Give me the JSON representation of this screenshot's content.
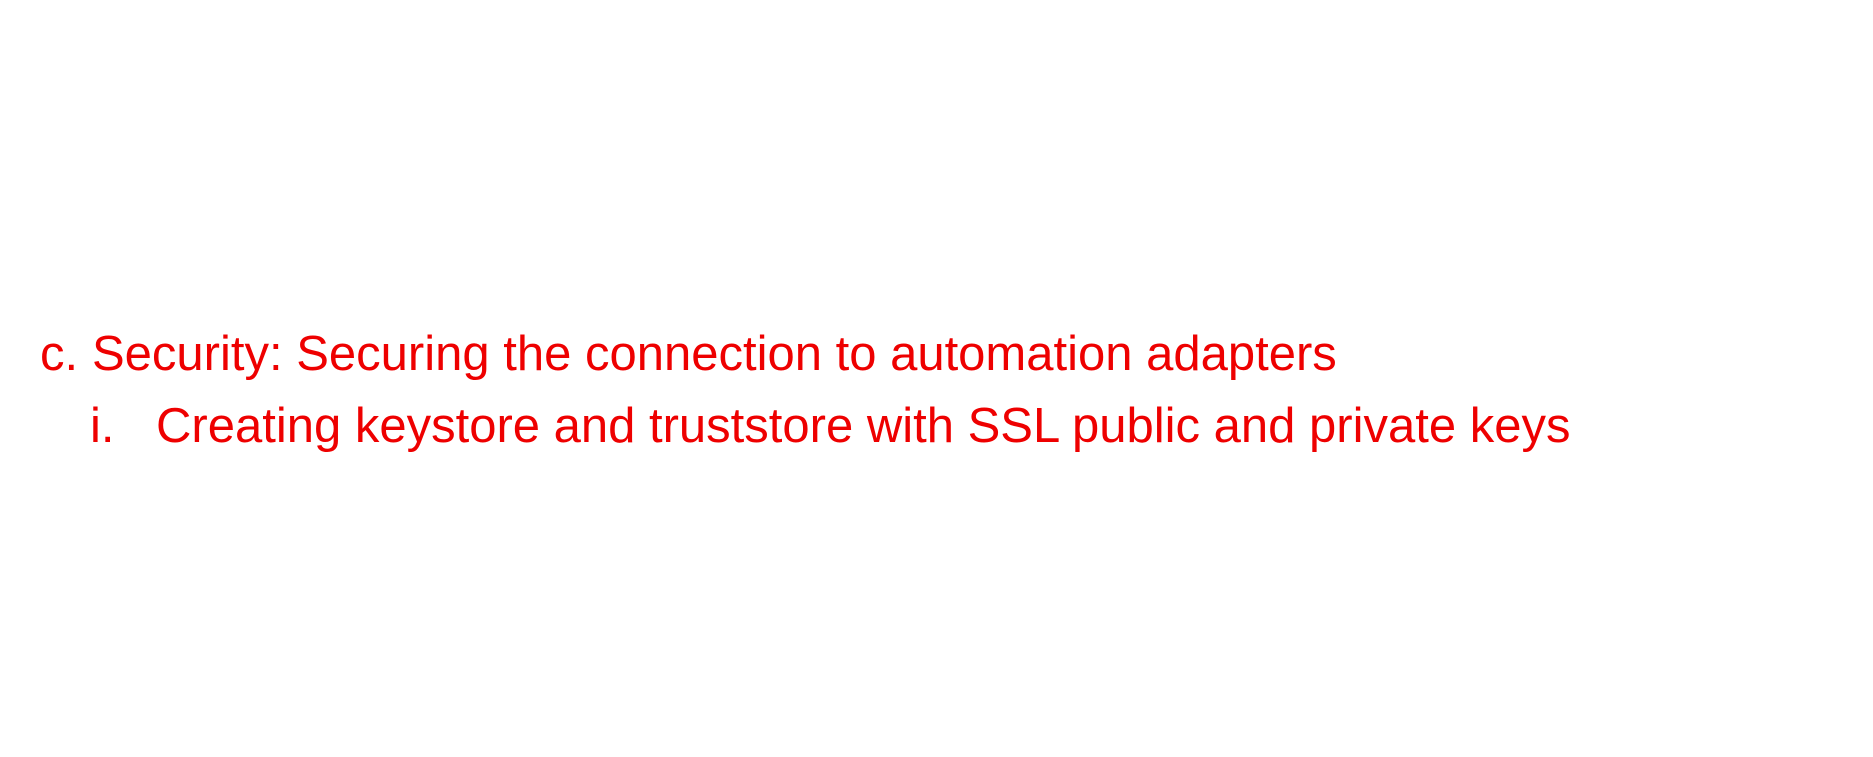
{
  "document": {
    "accent_color": "#ee0000",
    "items": [
      {
        "marker": "c.",
        "text": "Security: Securing the connection to automation adapters"
      }
    ],
    "subitems": [
      {
        "marker": "i.",
        "text": "Creating keystore and truststore with SSL public and private keys"
      }
    ]
  }
}
